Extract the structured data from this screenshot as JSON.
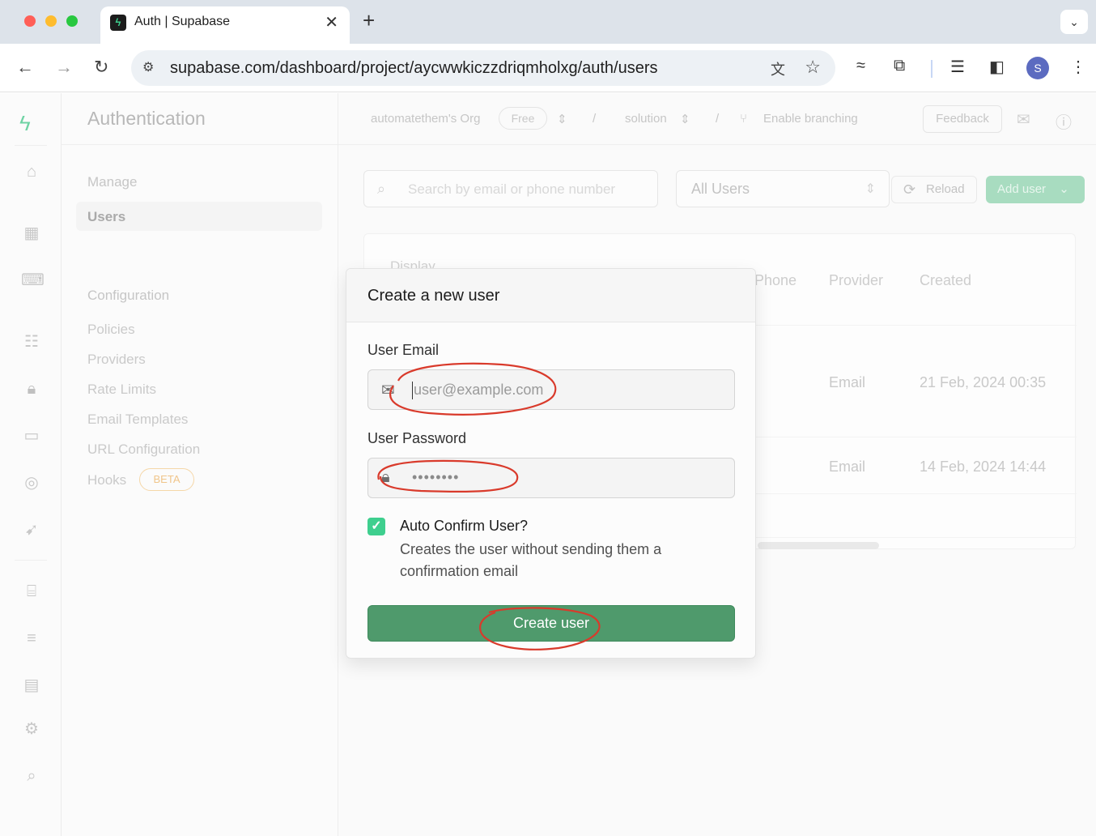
{
  "browser": {
    "tab_title": "Auth | Supabase",
    "tab_close": "✕",
    "new_tab": "+",
    "tab_menu": "⌄",
    "url": "supabase.com/dashboard/project/aycwwkiczzdriqmholxg/auth/users",
    "profile_initial": "S"
  },
  "sidebar": {
    "title": "Authentication",
    "section_manage": "Manage",
    "item_users": "Users",
    "section_configuration": "Configuration",
    "config_items": [
      "Policies",
      "Providers",
      "Rate Limits",
      "Email Templates",
      "URL Configuration",
      "Hooks"
    ],
    "beta_badge": "BETA"
  },
  "topbar": {
    "org": "automatethem's Org",
    "plan": "Free",
    "sep": "/",
    "project": "solution",
    "branching": "Enable branching",
    "feedback": "Feedback"
  },
  "toolbar": {
    "search_placeholder": "Search by email or phone number",
    "filter_value": "All Users",
    "reload": "Reload",
    "add_user": "Add user"
  },
  "table": {
    "headers": {
      "display": "Display",
      "phone": "Phone",
      "provider": "Provider",
      "created": "Created"
    },
    "rows": [
      {
        "provider": "Email",
        "created": "21 Feb, 2024 00:35"
      },
      {
        "provider": "Email",
        "created": "14 Feb, 2024 14:44"
      }
    ]
  },
  "modal": {
    "title": "Create a new user",
    "email_label": "User Email",
    "email_placeholder": "user@example.com",
    "password_label": "User Password",
    "password_value": "••••••••",
    "auto_confirm_label": "Auto Confirm User?",
    "auto_confirm_desc": "Creates the user without sending them a confirmation email",
    "create_button": "Create user"
  },
  "colors": {
    "brand_green": "#3ecf8e",
    "button_green": "#4f9a6c",
    "annotation_red": "#d93a2b"
  }
}
